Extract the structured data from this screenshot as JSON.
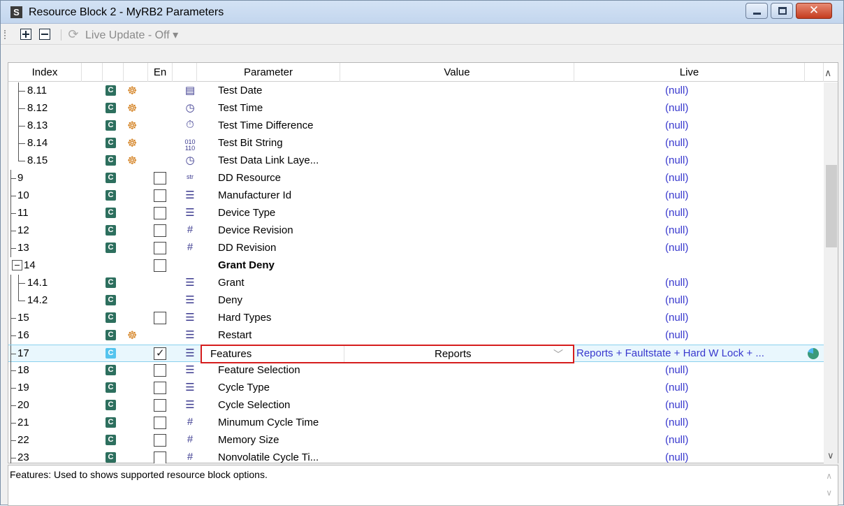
{
  "window": {
    "app_icon": "S",
    "title": "Resource Block 2 -  MyRB2 Parameters",
    "controls": {
      "minimize": "minimize-icon",
      "maximize": "maximize-icon",
      "close": "✕"
    }
  },
  "toolbar": {
    "expand_icon": "plus-box-icon",
    "collapse_icon": "minus-box-icon",
    "refresh_icon": "⟳",
    "live_update": "Live Update - Off ▾"
  },
  "columns": {
    "index": "Index",
    "en": "En",
    "parameter": "Parameter",
    "value": "Value",
    "live": "Live"
  },
  "rows": [
    {
      "index": "8.11",
      "c": "C",
      "param": "Test Date",
      "type": "▤",
      "live": "(null)"
    },
    {
      "index": "8.12",
      "c": "C",
      "param": "Test Time",
      "type": "◷",
      "live": "(null)"
    },
    {
      "index": "8.13",
      "c": "C",
      "param": "Test Time Difference",
      "type": "⏱",
      "live": "(null)"
    },
    {
      "index": "8.14",
      "c": "C",
      "param": "Test Bit String",
      "type": "010 110",
      "live": "(null)"
    },
    {
      "index": "8.15",
      "c": "C",
      "param": "Test Data Link Laye...",
      "type": "◷",
      "live": "(null)"
    },
    {
      "index": "9",
      "c": "C",
      "param": "DD Resource",
      "type": "str",
      "live": "(null)"
    },
    {
      "index": "10",
      "c": "C",
      "param": "Manufacturer Id",
      "type": "☰",
      "live": "(null)"
    },
    {
      "index": "11",
      "c": "C",
      "param": "Device Type",
      "type": "☰",
      "live": "(null)"
    },
    {
      "index": "12",
      "c": "C",
      "param": "Device Revision",
      "type": "#",
      "live": "(null)"
    },
    {
      "index": "13",
      "c": "C",
      "param": "DD Revision",
      "type": "#",
      "live": "(null)"
    },
    {
      "index": "14",
      "param": "Grant Deny"
    },
    {
      "index": "14.1",
      "c": "C",
      "param": "Grant",
      "type": "☰",
      "live": "(null)"
    },
    {
      "index": "14.2",
      "c": "C",
      "param": "Deny",
      "type": "☰",
      "live": "(null)"
    },
    {
      "index": "15",
      "c": "C",
      "param": "Hard Types",
      "type": "☰",
      "live": "(null)"
    },
    {
      "index": "16",
      "c": "C",
      "param": "Restart",
      "type": "☰",
      "live": "(null)"
    },
    {
      "index": "17",
      "c": "C",
      "param": "Features",
      "type": "☰",
      "value": "Reports",
      "live": "Reports + Faultstate + Hard W Lock + ..."
    },
    {
      "index": "18",
      "c": "C",
      "param": "Feature Selection",
      "type": "☰",
      "live": "(null)"
    },
    {
      "index": "19",
      "c": "C",
      "param": "Cycle Type",
      "type": "☰",
      "live": "(null)"
    },
    {
      "index": "20",
      "c": "C",
      "param": "Cycle Selection",
      "type": "☰",
      "live": "(null)"
    },
    {
      "index": "21",
      "c": "C",
      "param": "Minumum Cycle Time",
      "type": "#",
      "live": "(null)"
    },
    {
      "index": "22",
      "c": "C",
      "param": "Memory Size",
      "type": "#",
      "live": "(null)"
    },
    {
      "index": "23",
      "c": "C",
      "param": "Nonvolatile Cycle Ti...",
      "type": "#",
      "live": "(null)"
    }
  ],
  "icons": {
    "atom": "☸",
    "chevron": "﹀",
    "up": "∧",
    "down": "∨"
  },
  "description": "Features: Used to shows supported resource block options."
}
